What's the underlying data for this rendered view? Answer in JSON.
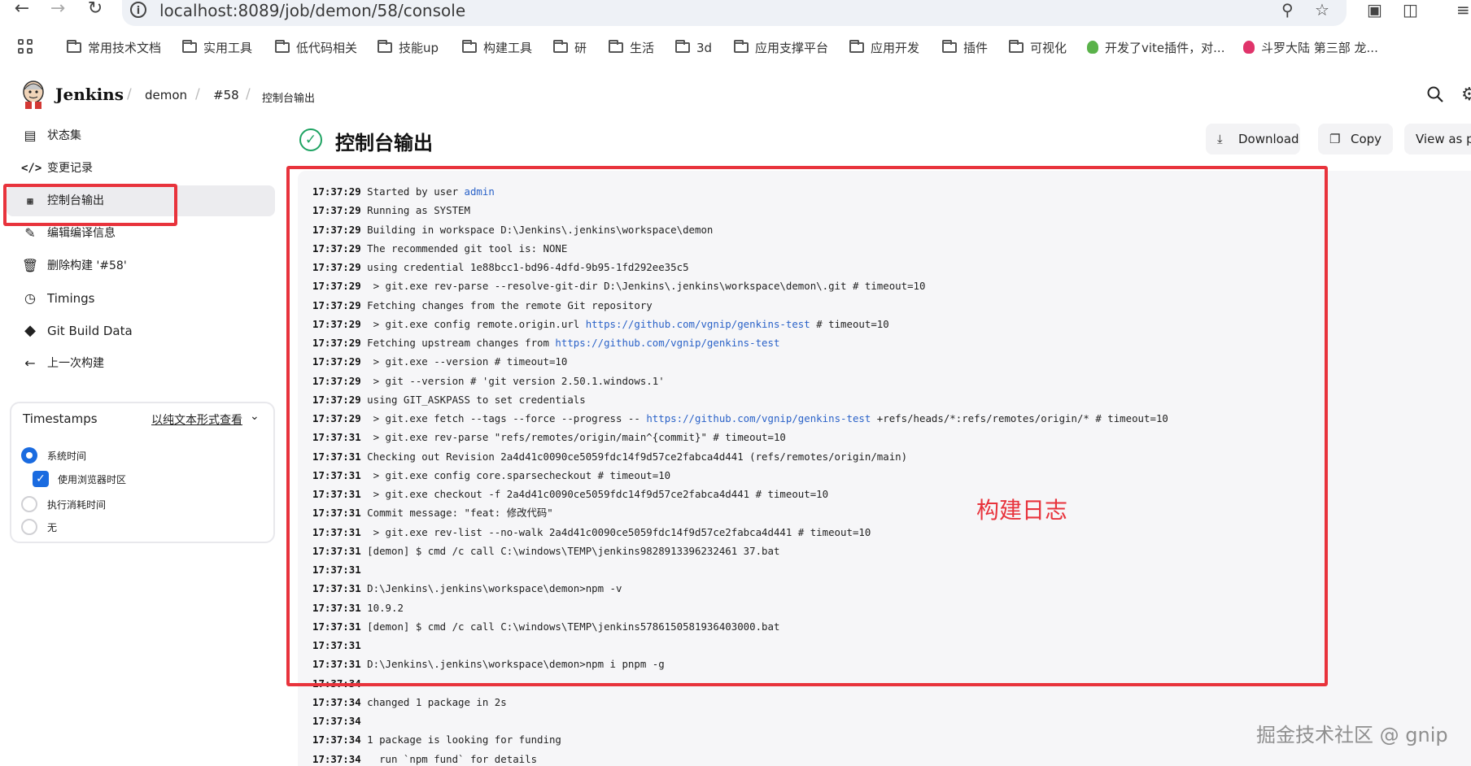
{
  "browser": {
    "url": "localhost:8089/job/demon/58/console",
    "bookmarks": [
      "常用技术文档",
      "实用工具",
      "低代码相关",
      "技能up",
      "构建工具",
      "研",
      "生活",
      "3d",
      "应用支撑平台",
      "应用开发",
      "插件",
      "可视化",
      "开发了vite插件，对...",
      "斗罗大陆 第三部 龙..."
    ]
  },
  "header": {
    "app_name": "Jenkins",
    "breadcrumbs": [
      "demon",
      "#58",
      "控制台输出"
    ]
  },
  "sidebar": {
    "items": [
      {
        "label": "状态集",
        "icon": "status-icon"
      },
      {
        "label": "变更记录",
        "icon": "code-icon"
      },
      {
        "label": "控制台输出",
        "icon": "terminal-icon"
      },
      {
        "label": "编辑编译信息",
        "icon": "edit-icon"
      },
      {
        "label": "删除构建 '#58'",
        "icon": "trash-icon"
      },
      {
        "label": "Timings",
        "icon": "clock-icon"
      },
      {
        "label": "Git Build Data",
        "icon": "git-icon"
      },
      {
        "label": "上一次构建",
        "icon": "arrow-left-icon"
      }
    ],
    "timestamps": {
      "title": "Timestamps",
      "link": "以纯文本形式查看",
      "options": [
        "系统时间",
        "使用浏览器时区",
        "执行消耗时间",
        "无"
      ]
    }
  },
  "main": {
    "title": "控制台输出",
    "buttons": {
      "download": "Download",
      "copy": "Copy",
      "view_plain": "View as pl"
    }
  },
  "log": [
    {
      "ts": "17:37:29",
      "segs": [
        {
          "t": "Started by user "
        },
        {
          "t": "admin",
          "link": true
        }
      ]
    },
    {
      "ts": "17:37:29",
      "segs": [
        {
          "t": "Running as SYSTEM"
        }
      ]
    },
    {
      "ts": "17:37:29",
      "segs": [
        {
          "t": "Building in workspace D:\\Jenkins\\.jenkins\\workspace\\demon"
        }
      ]
    },
    {
      "ts": "17:37:29",
      "segs": [
        {
          "t": "The recommended git tool is: NONE"
        }
      ]
    },
    {
      "ts": "17:37:29",
      "segs": [
        {
          "t": "using credential 1e88bcc1-bd96-4dfd-9b95-1fd292ee35c5"
        }
      ]
    },
    {
      "ts": "17:37:29",
      "segs": [
        {
          "t": " > git.exe rev-parse --resolve-git-dir D:\\Jenkins\\.jenkins\\workspace\\demon\\.git # timeout=10"
        }
      ]
    },
    {
      "ts": "17:37:29",
      "segs": [
        {
          "t": "Fetching changes from the remote Git repository"
        }
      ]
    },
    {
      "ts": "17:37:29",
      "segs": [
        {
          "t": " > git.exe config remote.origin.url "
        },
        {
          "t": "https://github.com/vgnip/genkins-test",
          "link": true
        },
        {
          "t": " # timeout=10"
        }
      ]
    },
    {
      "ts": "17:37:29",
      "segs": [
        {
          "t": "Fetching upstream changes from "
        },
        {
          "t": "https://github.com/vgnip/genkins-test",
          "link": true
        }
      ]
    },
    {
      "ts": "17:37:29",
      "segs": [
        {
          "t": " > git.exe --version # timeout=10"
        }
      ]
    },
    {
      "ts": "17:37:29",
      "segs": [
        {
          "t": " > git --version # 'git version 2.50.1.windows.1'"
        }
      ]
    },
    {
      "ts": "17:37:29",
      "segs": [
        {
          "t": "using GIT_ASKPASS to set credentials"
        }
      ]
    },
    {
      "ts": "17:37:29",
      "segs": [
        {
          "t": " > git.exe fetch --tags --force --progress -- "
        },
        {
          "t": "https://github.com/vgnip/genkins-test",
          "link": true
        },
        {
          "t": " +refs/heads/*:refs/remotes/origin/* # timeout=10"
        }
      ]
    },
    {
      "ts": "17:37:31",
      "segs": [
        {
          "t": " > git.exe rev-parse \"refs/remotes/origin/main^{commit}\" # timeout=10"
        }
      ]
    },
    {
      "ts": "17:37:31",
      "segs": [
        {
          "t": "Checking out Revision 2a4d41c0090ce5059fdc14f9d57ce2fabca4d441 (refs/remotes/origin/main)"
        }
      ]
    },
    {
      "ts": "17:37:31",
      "segs": [
        {
          "t": " > git.exe config core.sparsecheckout # timeout=10"
        }
      ]
    },
    {
      "ts": "17:37:31",
      "segs": [
        {
          "t": " > git.exe checkout -f 2a4d41c0090ce5059fdc14f9d57ce2fabca4d441 # timeout=10"
        }
      ]
    },
    {
      "ts": "17:37:31",
      "segs": [
        {
          "t": "Commit message: \"feat: 修改代码\""
        }
      ]
    },
    {
      "ts": "17:37:31",
      "segs": [
        {
          "t": " > git.exe rev-list --no-walk 2a4d41c0090ce5059fdc14f9d57ce2fabca4d441 # timeout=10"
        }
      ]
    },
    {
      "ts": "17:37:31",
      "segs": [
        {
          "t": "[demon] $ cmd /c call C:\\windows\\TEMP\\jenkins9828913396232461 37.bat"
        }
      ]
    },
    {
      "ts": "17:37:31",
      "segs": [
        {
          "t": ""
        }
      ]
    },
    {
      "ts": "17:37:31",
      "segs": [
        {
          "t": "D:\\Jenkins\\.jenkins\\workspace\\demon>npm -v"
        }
      ]
    },
    {
      "ts": "17:37:31",
      "segs": [
        {
          "t": "10.9.2"
        }
      ]
    },
    {
      "ts": "17:37:31",
      "segs": [
        {
          "t": "[demon] $ cmd /c call C:\\windows\\TEMP\\jenkins5786150581936403000.bat"
        }
      ]
    },
    {
      "ts": "17:37:31",
      "segs": [
        {
          "t": ""
        }
      ]
    },
    {
      "ts": "17:37:31",
      "segs": [
        {
          "t": "D:\\Jenkins\\.jenkins\\workspace\\demon>npm i pnpm -g"
        }
      ]
    },
    {
      "ts": "17:37:34",
      "segs": [
        {
          "t": ""
        }
      ]
    },
    {
      "ts": "17:37:34",
      "segs": [
        {
          "t": "changed 1 package in 2s"
        }
      ]
    },
    {
      "ts": "17:37:34",
      "segs": [
        {
          "t": ""
        }
      ]
    },
    {
      "ts": "17:37:34",
      "segs": [
        {
          "t": "1 package is looking for funding"
        }
      ]
    },
    {
      "ts": "17:37:34",
      "segs": [
        {
          "t": "  run `npm fund` for details"
        }
      ]
    }
  ],
  "annotation": "构建日志",
  "watermark": "掘金技术社区 @ gnip",
  "colors": {
    "accent": "#1a6be0",
    "success": "#1ea362",
    "highlight_red": "#e8333c",
    "link": "#2a62c8"
  }
}
